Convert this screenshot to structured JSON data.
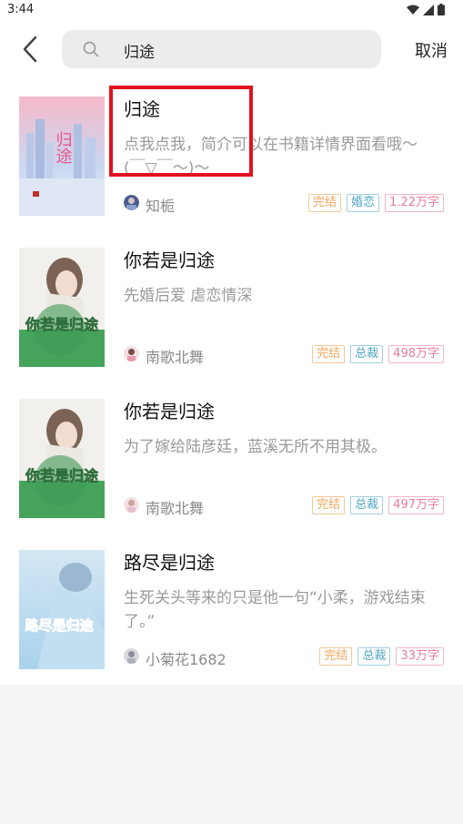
{
  "status": {
    "time": "3:44"
  },
  "search": {
    "query": "归途",
    "cancel_label": "取消"
  },
  "results": [
    {
      "title": "归途",
      "desc": "点我点我，简介可以在书籍详情界面看哦～(￣▽￣～)～",
      "author": "知栀",
      "status": "完结",
      "category": "婚恋",
      "words": "1.22万字"
    },
    {
      "title": "你若是归途",
      "desc": "先婚后爱 虐恋情深",
      "author": "南歌北舞",
      "status": "完结",
      "category": "总裁",
      "words": "498万字"
    },
    {
      "title": "你若是归途",
      "desc": "为了嫁给陆彦廷，蓝溪无所不用其极。",
      "author": "南歌北舞",
      "status": "完结",
      "category": "总裁",
      "words": "497万字"
    },
    {
      "title": "路尽是归途",
      "desc": "生死关头等来的只是他一句“小柔，游戏结束了。”",
      "author": "小菊花1682",
      "status": "完结",
      "category": "总裁",
      "words": "33万字"
    }
  ],
  "covers": [
    {
      "text": "归途"
    },
    {
      "text": "你若是归途"
    },
    {
      "text": "你若是归途"
    },
    {
      "text": "路尽是归途"
    }
  ]
}
